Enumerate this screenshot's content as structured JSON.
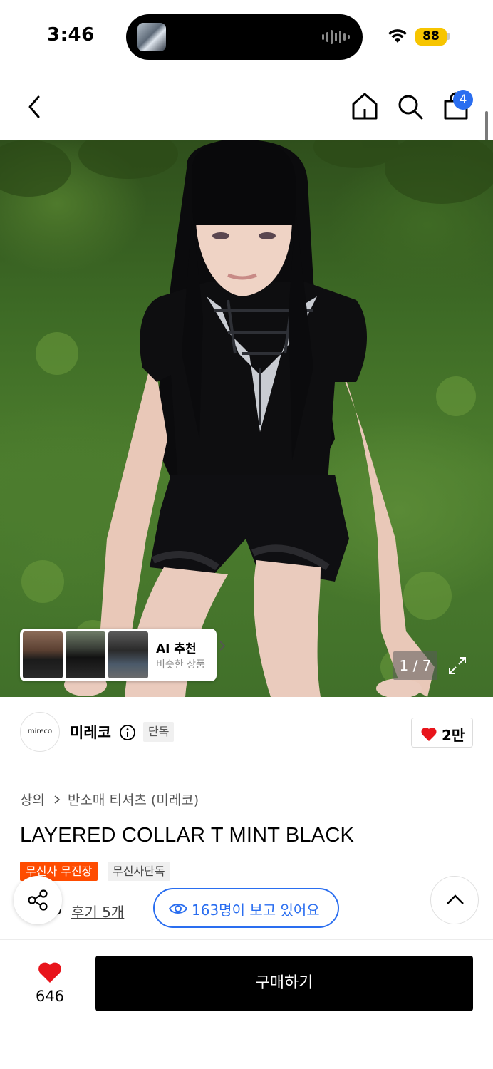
{
  "status_bar": {
    "time": "3:46",
    "battery": "88"
  },
  "nav": {
    "cart_count": "4"
  },
  "gallery": {
    "ai_title": "AI 추천",
    "ai_subtitle": "비슷한 상품",
    "counter": "1 / 7"
  },
  "brand": {
    "logo_text": "mireco",
    "name": "미레코",
    "exclusive_badge": "단독",
    "likes": "2만"
  },
  "product": {
    "breadcrumb": [
      "상의",
      "반소매 티셔츠 (미레코)"
    ],
    "title": "LAYERED COLLAR T MINT BLACK",
    "tags": [
      "무신사 무진장",
      "무신사단독"
    ],
    "rating_partial": "6",
    "reviews": "후기 5개",
    "viewers": "163명이 보고 있어요"
  },
  "bottom_bar": {
    "like_count": "646",
    "buy_label": "구매하기"
  },
  "colors": {
    "accent_blue": "#2a6ef0",
    "tag_orange": "#ff4c00",
    "heart_red": "#e8141b"
  }
}
